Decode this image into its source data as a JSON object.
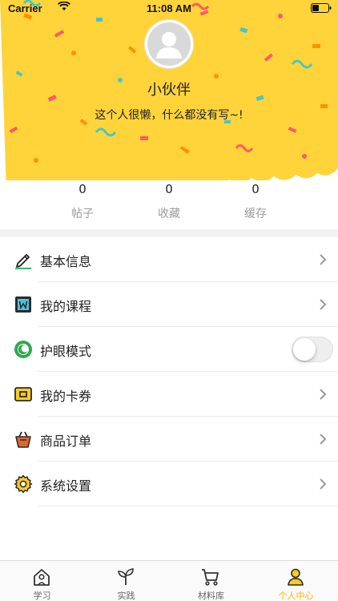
{
  "status_bar": {
    "carrier": "Carrier",
    "time": "11:08 AM"
  },
  "profile": {
    "username": "小伙伴",
    "bio": "这个人很懒，什么都没有写~!"
  },
  "stats": [
    {
      "value": "0",
      "label": "帖子"
    },
    {
      "value": "0",
      "label": "收藏"
    },
    {
      "value": "0",
      "label": "缓存"
    }
  ],
  "menu": [
    {
      "label": "基本信息",
      "icon": "edit-icon"
    },
    {
      "label": "我的课程",
      "icon": "course-icon"
    },
    {
      "label": "护眼模式",
      "icon": "eye-mode-icon",
      "toggle_on": false
    },
    {
      "label": "我的卡券",
      "icon": "coupon-icon"
    },
    {
      "label": "商品订单",
      "icon": "order-basket-icon"
    },
    {
      "label": "系统设置",
      "icon": "gear-icon"
    }
  ],
  "tabs": [
    {
      "label": "学习",
      "icon": "home-icon",
      "active": false
    },
    {
      "label": "实践",
      "icon": "sprout-icon",
      "active": false
    },
    {
      "label": "材料库",
      "icon": "cart-icon",
      "active": false
    },
    {
      "label": "个人中心",
      "icon": "person-icon",
      "active": true
    }
  ],
  "colors": {
    "brand_yellow": "#ffd43b",
    "active_tab": "#f5b800",
    "band": "#f2f2f5"
  }
}
